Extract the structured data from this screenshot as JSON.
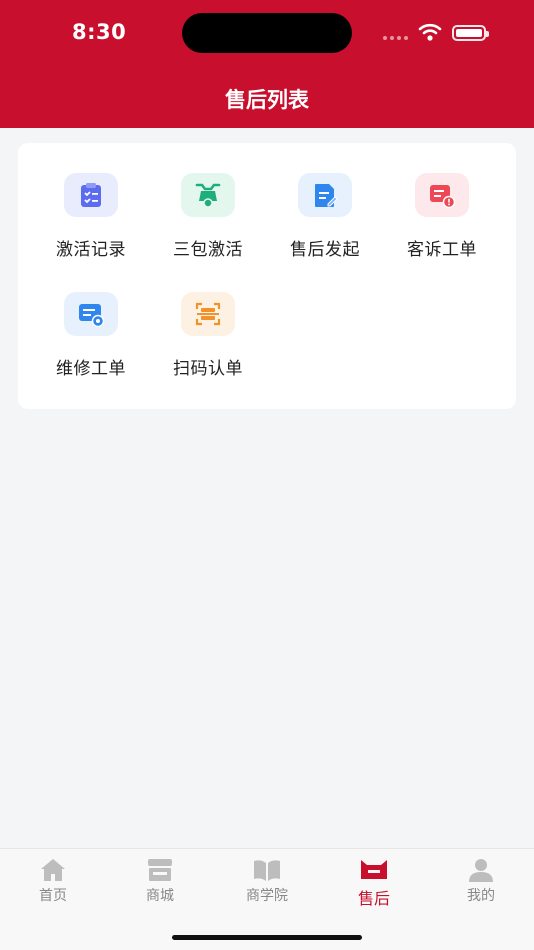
{
  "status_bar": {
    "time": "8:30"
  },
  "header": {
    "title": "售后列表"
  },
  "menu": [
    {
      "label": "激活记录",
      "icon": "clipboard-checklist-icon",
      "bg": "#e9ecfd",
      "color": "#5b6cf0"
    },
    {
      "label": "三包激活",
      "icon": "scooter-icon",
      "bg": "#e3f7ef",
      "color": "#1fae7a"
    },
    {
      "label": "售后发起",
      "icon": "document-edit-icon",
      "bg": "#e6f1fd",
      "color": "#2f86ee"
    },
    {
      "label": "客诉工单",
      "icon": "complaint-message-icon",
      "bg": "#fde9ec",
      "color": "#ee4755"
    },
    {
      "label": "维修工单",
      "icon": "repair-order-eye-icon",
      "bg": "#e6f1fd",
      "color": "#2f86ee"
    },
    {
      "label": "扫码认单",
      "icon": "scan-code-icon",
      "bg": "#fdf1e3",
      "color": "#f2922a"
    }
  ],
  "tabbar": [
    {
      "label": "首页",
      "icon": "home-icon",
      "active": false
    },
    {
      "label": "商城",
      "icon": "store-icon",
      "active": false
    },
    {
      "label": "商学院",
      "icon": "book-icon",
      "active": false
    },
    {
      "label": "售后",
      "icon": "after-sales-icon",
      "active": true
    },
    {
      "label": "我的",
      "icon": "user-icon",
      "active": false
    }
  ],
  "colors": {
    "brand": "#c8102e",
    "inactive_tab": "#bdbdbd"
  }
}
